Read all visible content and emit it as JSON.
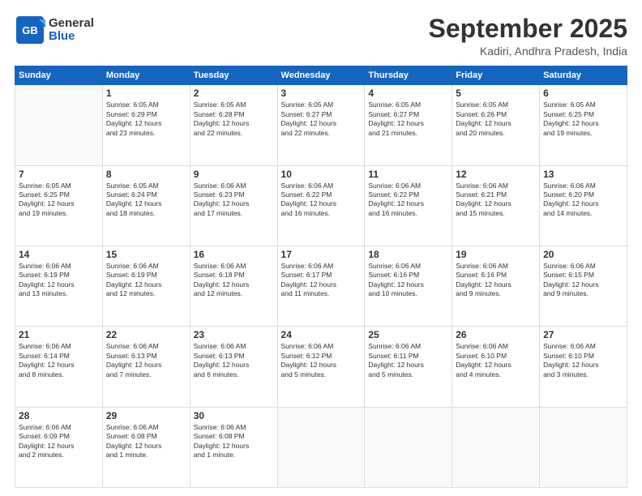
{
  "header": {
    "logo_general": "General",
    "logo_blue": "Blue",
    "month_title": "September 2025",
    "location": "Kadiri, Andhra Pradesh, India"
  },
  "calendar": {
    "columns": [
      "Sunday",
      "Monday",
      "Tuesday",
      "Wednesday",
      "Thursday",
      "Friday",
      "Saturday"
    ],
    "rows": [
      [
        {
          "day": "",
          "info": ""
        },
        {
          "day": "1",
          "info": "Sunrise: 6:05 AM\nSunset: 6:29 PM\nDaylight: 12 hours\nand 23 minutes."
        },
        {
          "day": "2",
          "info": "Sunrise: 6:05 AM\nSunset: 6:28 PM\nDaylight: 12 hours\nand 22 minutes."
        },
        {
          "day": "3",
          "info": "Sunrise: 6:05 AM\nSunset: 6:27 PM\nDaylight: 12 hours\nand 22 minutes."
        },
        {
          "day": "4",
          "info": "Sunrise: 6:05 AM\nSunset: 6:27 PM\nDaylight: 12 hours\nand 21 minutes."
        },
        {
          "day": "5",
          "info": "Sunrise: 6:05 AM\nSunset: 6:26 PM\nDaylight: 12 hours\nand 20 minutes."
        },
        {
          "day": "6",
          "info": "Sunrise: 6:05 AM\nSunset: 6:25 PM\nDaylight: 12 hours\nand 19 minutes."
        }
      ],
      [
        {
          "day": "7",
          "info": "Sunrise: 6:05 AM\nSunset: 6:25 PM\nDaylight: 12 hours\nand 19 minutes."
        },
        {
          "day": "8",
          "info": "Sunrise: 6:05 AM\nSunset: 6:24 PM\nDaylight: 12 hours\nand 18 minutes."
        },
        {
          "day": "9",
          "info": "Sunrise: 6:06 AM\nSunset: 6:23 PM\nDaylight: 12 hours\nand 17 minutes."
        },
        {
          "day": "10",
          "info": "Sunrise: 6:06 AM\nSunset: 6:22 PM\nDaylight: 12 hours\nand 16 minutes."
        },
        {
          "day": "11",
          "info": "Sunrise: 6:06 AM\nSunset: 6:22 PM\nDaylight: 12 hours\nand 16 minutes."
        },
        {
          "day": "12",
          "info": "Sunrise: 6:06 AM\nSunset: 6:21 PM\nDaylight: 12 hours\nand 15 minutes."
        },
        {
          "day": "13",
          "info": "Sunrise: 6:06 AM\nSunset: 6:20 PM\nDaylight: 12 hours\nand 14 minutes."
        }
      ],
      [
        {
          "day": "14",
          "info": "Sunrise: 6:06 AM\nSunset: 6:19 PM\nDaylight: 12 hours\nand 13 minutes."
        },
        {
          "day": "15",
          "info": "Sunrise: 6:06 AM\nSunset: 6:19 PM\nDaylight: 12 hours\nand 12 minutes."
        },
        {
          "day": "16",
          "info": "Sunrise: 6:06 AM\nSunset: 6:18 PM\nDaylight: 12 hours\nand 12 minutes."
        },
        {
          "day": "17",
          "info": "Sunrise: 6:06 AM\nSunset: 6:17 PM\nDaylight: 12 hours\nand 11 minutes."
        },
        {
          "day": "18",
          "info": "Sunrise: 6:06 AM\nSunset: 6:16 PM\nDaylight: 12 hours\nand 10 minutes."
        },
        {
          "day": "19",
          "info": "Sunrise: 6:06 AM\nSunset: 6:16 PM\nDaylight: 12 hours\nand 9 minutes."
        },
        {
          "day": "20",
          "info": "Sunrise: 6:06 AM\nSunset: 6:15 PM\nDaylight: 12 hours\nand 9 minutes."
        }
      ],
      [
        {
          "day": "21",
          "info": "Sunrise: 6:06 AM\nSunset: 6:14 PM\nDaylight: 12 hours\nand 8 minutes."
        },
        {
          "day": "22",
          "info": "Sunrise: 6:06 AM\nSunset: 6:13 PM\nDaylight: 12 hours\nand 7 minutes."
        },
        {
          "day": "23",
          "info": "Sunrise: 6:06 AM\nSunset: 6:13 PM\nDaylight: 12 hours\nand 6 minutes."
        },
        {
          "day": "24",
          "info": "Sunrise: 6:06 AM\nSunset: 6:12 PM\nDaylight: 12 hours\nand 5 minutes."
        },
        {
          "day": "25",
          "info": "Sunrise: 6:06 AM\nSunset: 6:11 PM\nDaylight: 12 hours\nand 5 minutes."
        },
        {
          "day": "26",
          "info": "Sunrise: 6:06 AM\nSunset: 6:10 PM\nDaylight: 12 hours\nand 4 minutes."
        },
        {
          "day": "27",
          "info": "Sunrise: 6:06 AM\nSunset: 6:10 PM\nDaylight: 12 hours\nand 3 minutes."
        }
      ],
      [
        {
          "day": "28",
          "info": "Sunrise: 6:06 AM\nSunset: 6:09 PM\nDaylight: 12 hours\nand 2 minutes."
        },
        {
          "day": "29",
          "info": "Sunrise: 6:06 AM\nSunset: 6:08 PM\nDaylight: 12 hours\nand 1 minute."
        },
        {
          "day": "30",
          "info": "Sunrise: 6:06 AM\nSunset: 6:08 PM\nDaylight: 12 hours\nand 1 minute."
        },
        {
          "day": "",
          "info": ""
        },
        {
          "day": "",
          "info": ""
        },
        {
          "day": "",
          "info": ""
        },
        {
          "day": "",
          "info": ""
        }
      ]
    ]
  }
}
